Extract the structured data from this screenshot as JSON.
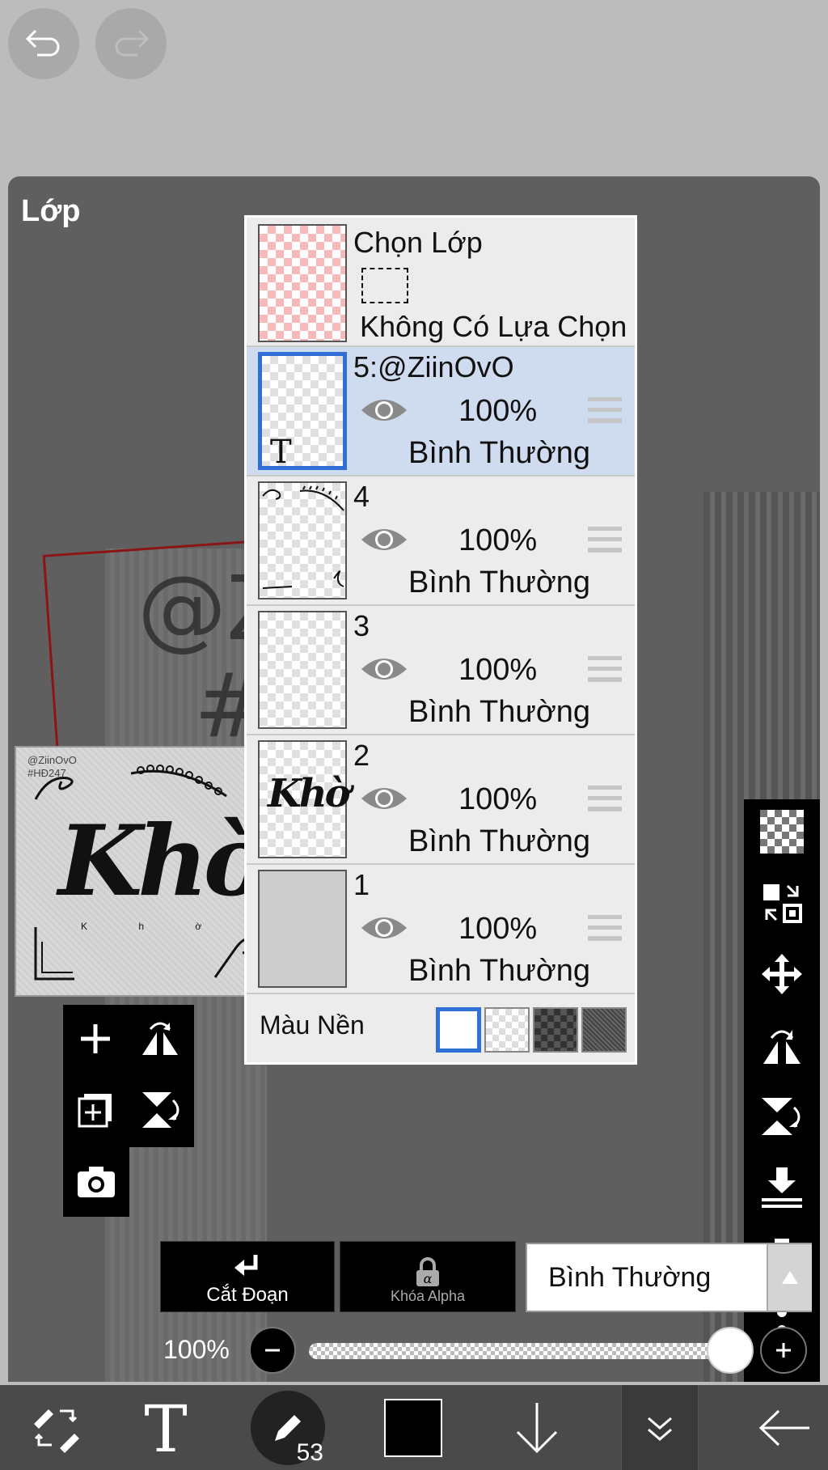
{
  "panel": {
    "title": "Lớp"
  },
  "canvas_bg": {
    "at_text": "@Z",
    "hash_text": "#H"
  },
  "preview": {
    "watermark_line1": "@ZiinOvO",
    "watermark_line2": "#HĐ247",
    "big_text": "Khờ",
    "small_text": "K h ờ"
  },
  "selection_row": {
    "title": "Chọn Lớp",
    "status": "Không Có Lựa Chọn"
  },
  "layers": [
    {
      "name": "5:@ZiinOvO",
      "opacity": "100%",
      "blend": "Bình Thường",
      "selected": true,
      "thumb_label": "T"
    },
    {
      "name": "4",
      "opacity": "100%",
      "blend": "Bình Thường",
      "selected": false
    },
    {
      "name": "3",
      "opacity": "100%",
      "blend": "Bình Thường",
      "selected": false
    },
    {
      "name": "2",
      "opacity": "100%",
      "blend": "Bình Thường",
      "selected": false,
      "thumb_label": "Khờ"
    },
    {
      "name": "1",
      "opacity": "100%",
      "blend": "Bình Thường",
      "selected": false
    }
  ],
  "bg_color": {
    "label": "Màu Nền"
  },
  "actions": {
    "clip_label": "Cắt Đoạn",
    "alpha_lock_label": "Khóa Alpha",
    "blend_mode_value": "Bình Thường"
  },
  "opacity_control": {
    "value_label": "100%",
    "level": 1.0
  },
  "bottom_bar": {
    "brush_size": "53"
  },
  "colors": {
    "selected_row": "#cfdbee",
    "selection_blue": "#2f6fd6",
    "current_color": "#000000"
  }
}
